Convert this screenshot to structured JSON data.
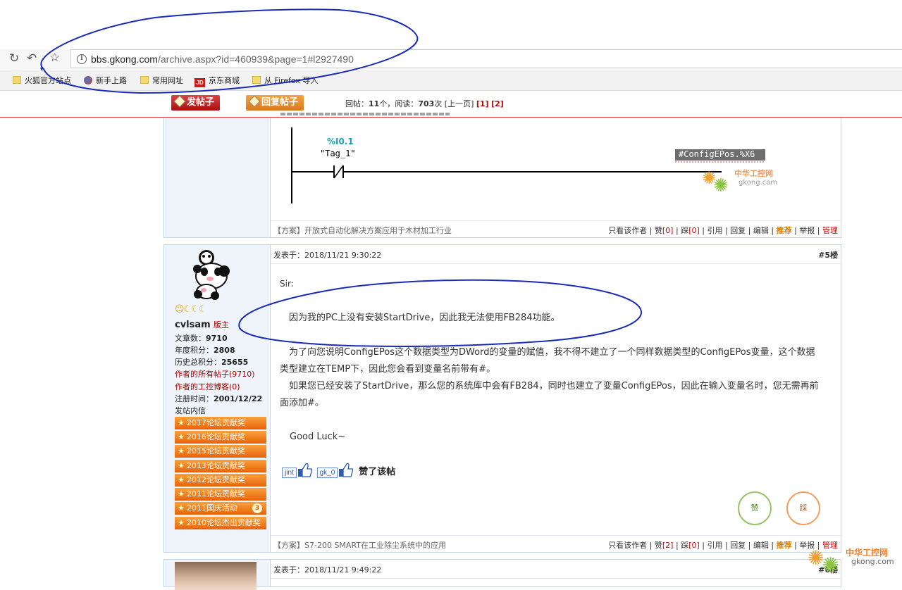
{
  "browser": {
    "url_host": "bbs.gkong.com",
    "url_path": "/archive.aspx?id=460939&page=1#l2927490",
    "bookmarks": [
      "火狐官方站点",
      "新手上路",
      "常用网址",
      "京东商城",
      "从 Firefox 导入"
    ],
    "jd_logo": "JD"
  },
  "postbar": {
    "new_post_label": "发帖子",
    "reply_label": "回复帖子",
    "replies_prefix": "回帖：",
    "replies_count": "11",
    "replies_unit": "个，阅读：",
    "views_count": "703",
    "views_unit": "次 [上一页] ",
    "page1": "[1]",
    "page2": "[2]"
  },
  "prev_post": {
    "code_address": "%I0.1",
    "tag_name": "\"Tag_1\"",
    "coil_label": "#ConfigEPos.%X6",
    "watermark_cn": "中华工控网",
    "watermark_en": "gkong.com",
    "foot_link": "【方案】开放式自动化解决方案应用于木材加工行业",
    "actions": {
      "only_author": "只看该作者",
      "like": "赞",
      "like_count": "[0]",
      "dislike": "踩",
      "dislike_count": "[0]",
      "quote": "引用",
      "reply": "回复",
      "edit": "编辑",
      "recommend": "推荐",
      "report": "举报",
      "manage": "管理"
    }
  },
  "post5": {
    "date": "发表于：2018/11/21 9:30:22",
    "floor": "#5楼",
    "author": {
      "name": "cvlsam",
      "role": "版主",
      "articles_label": "文章数：",
      "articles": "9710",
      "year_points_label": "年度积分：",
      "year_points": "2808",
      "total_points_label": "历史总积分：",
      "total_points": "25655",
      "all_posts_link": "作者的所有帖子(9710)",
      "blog_link": "作者的工控博客(0)",
      "reg_label": "注册时间：",
      "reg_date": "2001/12/22",
      "pm": "发站内信",
      "awards": [
        "2017论坛贡献奖",
        "2016论坛贡献奖",
        "2015论坛贡献奖",
        "2013论坛贡献奖",
        "2012论坛贡献奖",
        "2011论坛贡献奖",
        "2011国庆活动",
        "2010论坛杰出贡献奖"
      ],
      "award_badge": "3"
    },
    "body": {
      "line1": "Sir:",
      "line2": "因为我的PC上没有安装StartDrive，因此我无法使用FB284功能。",
      "line3": "为了向您说明ConfigEPos这个数据类型为DWord的变量的赋值，我不得不建立了一个同样数据类型的ConfigEPos变量，这个数据",
      "line4": "类型建立在TEMP下，因此您会看到变量名前带有#。",
      "line5": "如果您已经安装了StartDrive，那么您的系统库中会有FB284，同时也建立了变量ConfigEPos，因此在输入变量名时，您无需再前",
      "line6": "面添加#。",
      "line7": "Good Luck~"
    },
    "likers": [
      "jint",
      "gk_0"
    ],
    "liked_text": "赞了该帖",
    "like_btn": "赞",
    "dislike_btn": "踩",
    "foot_link": "【方案】S7-200 SMART在工业除尘系统中的应用",
    "actions": {
      "only_author": "只看该作者",
      "like": "赞",
      "like_count": "[2]",
      "dislike": "踩",
      "dislike_count": "[0]",
      "quote": "引用",
      "reply": "回复",
      "edit": "编辑",
      "recommend": "推荐",
      "report": "举报",
      "manage": "管理"
    }
  },
  "post6": {
    "date": "发表于：2018/11/21 9:49:22",
    "floor": "#6楼"
  },
  "corner_watermark": {
    "cn": "中华工控网",
    "en": "gkong.com"
  },
  "colors": {
    "accent_red": "#c00",
    "award_orange": "#e8630b",
    "border_blue": "#c3d6e6",
    "annotation_ink": "#1a2bb8"
  }
}
